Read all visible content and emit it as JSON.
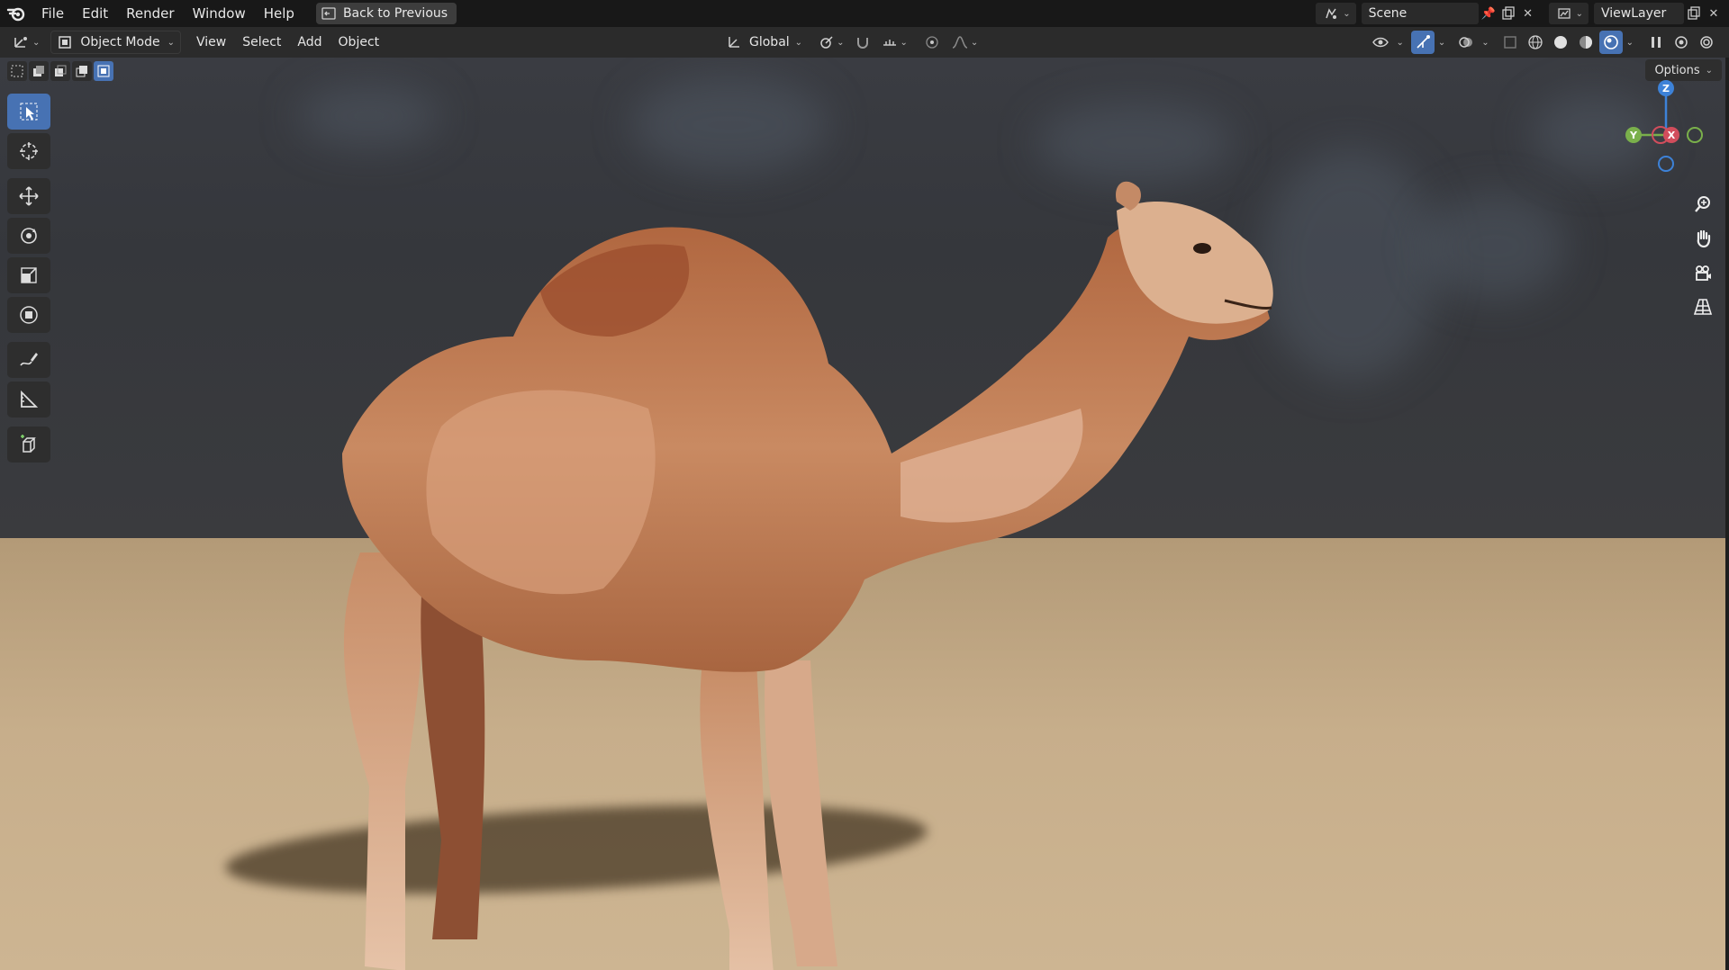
{
  "topbar": {
    "menu": [
      "File",
      "Edit",
      "Render",
      "Window",
      "Help"
    ],
    "back_button": "Back to Previous",
    "scene": "Scene",
    "view_layer": "ViewLayer"
  },
  "header": {
    "mode": "Object Mode",
    "menus": [
      "View",
      "Select",
      "Add",
      "Object"
    ],
    "transform_orientation": "Global"
  },
  "viewport": {
    "options_label": "Options",
    "gizmo": {
      "z": "Z",
      "y": "Y",
      "x": "X"
    }
  },
  "colors": {
    "accent": "#4772b3",
    "topbar_bg": "#181818",
    "header_bg": "#2b2b2b",
    "sky": "#3a3c42",
    "ground": "#c7ae8b",
    "axis_x": "#d14d5c",
    "axis_y": "#7ab04b",
    "axis_z": "#3d82d8"
  },
  "icons": {
    "toolbar": [
      "select-box-icon",
      "cursor-icon",
      "move-icon",
      "rotate-icon",
      "scale-icon",
      "transform-icon",
      "annotate-icon",
      "measure-icon",
      "add-cube-icon"
    ],
    "navigation": [
      "zoom-icon",
      "hand-pan-icon",
      "camera-icon",
      "perspective-grid-icon"
    ]
  }
}
